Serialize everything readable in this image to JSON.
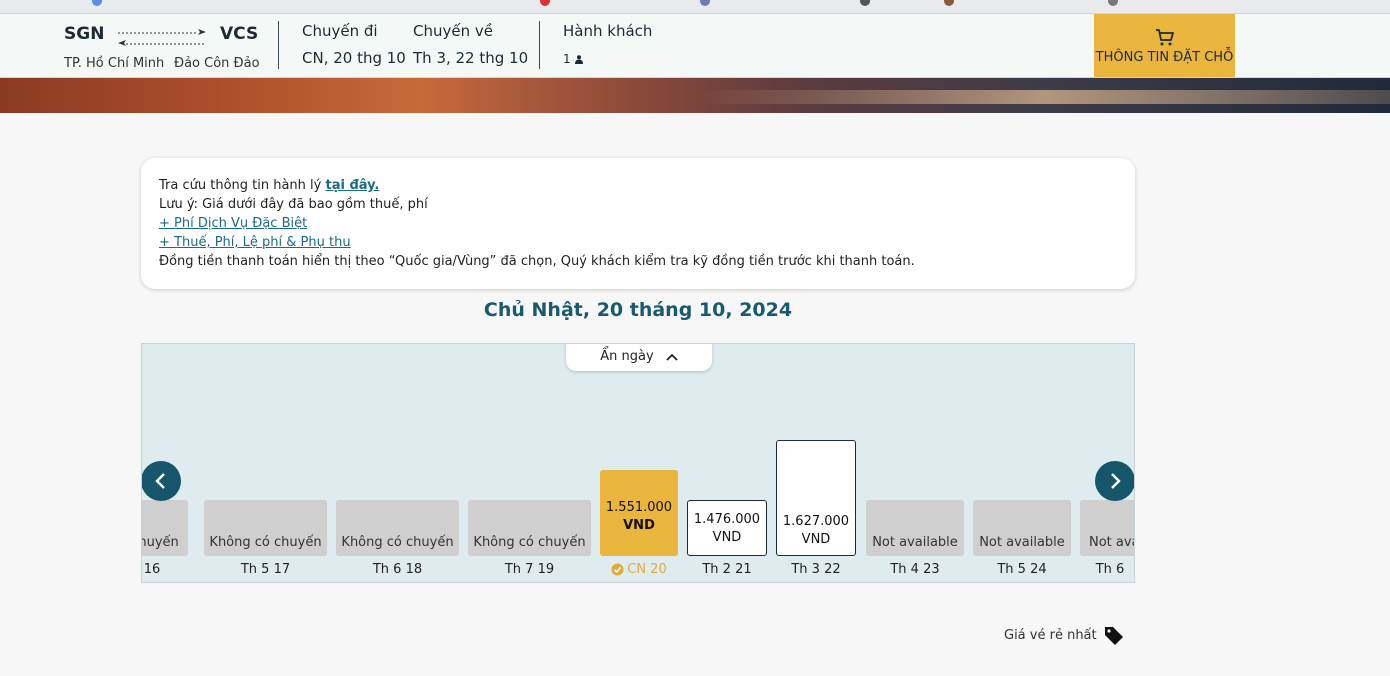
{
  "header": {
    "origin_code": "SGN",
    "origin_city": "TP. Hồ Chí Minh",
    "dest_code": "VCS",
    "dest_city": "Đảo Côn Đảo",
    "depart_label": "Chuyến đi",
    "depart_value": "CN, 20 thg 10",
    "return_label": "Chuyến về",
    "return_value": "Th 3, 22 thg 10",
    "pax_label": "Hành khách",
    "pax_value": "1",
    "cart_label": "THÔNG TIN ĐẶT CHỖ"
  },
  "info": {
    "baggage_text": "Tra cứu thông tin hành lý",
    "baggage_link": "tại đây.",
    "note": "Lưu ý: Giá dưới đây đã bao gồm thuế, phí",
    "link_service": "+ Phí Dịch Vụ Đặc Biệt",
    "link_tax": "+ Thuế, Phí, Lệ phí & Phụ thu",
    "currency_note": "Đồng tiền thanh toán hiển thị theo “Quốc gia/Vùng” đã chọn, Quý khách kiểm tra kỹ đồng tiền trước khi thanh toán."
  },
  "date_title": "Chủ Nhật, 20 tháng 10, 2024",
  "calendar": {
    "toggle_label": "Ẩn ngày",
    "days": [
      {
        "price": "chuyến",
        "label": "16"
      },
      {
        "price": "Không có chuyến",
        "label": "Th 5 17"
      },
      {
        "price": "Không có chuyến",
        "label": "Th 6 18"
      },
      {
        "price": "Không có chuyến",
        "label": "Th 7 19"
      },
      {
        "price": "1.551.000",
        "currency": "VND",
        "label": "CN 20"
      },
      {
        "price": "1.476.000",
        "currency": "VND",
        "label": "Th 2 21"
      },
      {
        "price": "1.627.000",
        "currency": "VND",
        "label": "Th 3 22"
      },
      {
        "price": "Not available",
        "label": "Th 4 23"
      },
      {
        "price": "Not available",
        "label": "Th 5 24"
      },
      {
        "price": "Not ava",
        "label": "Th 6"
      }
    ]
  },
  "cheapest_label": "Giá vé rẻ nhất",
  "colors": {
    "accent": "#e9b53c",
    "primary": "#15566b",
    "title": "#1a5a6e"
  }
}
